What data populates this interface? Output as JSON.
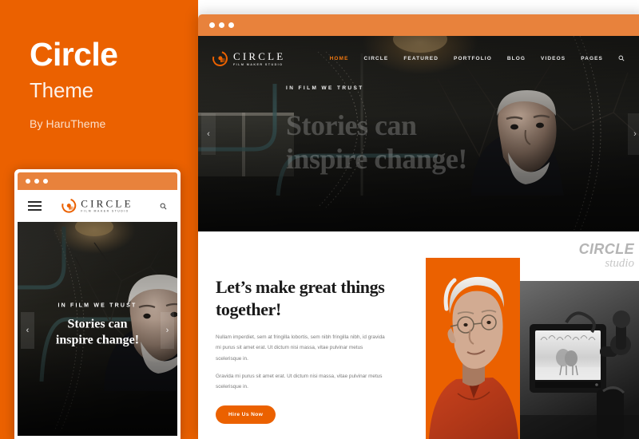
{
  "promo": {
    "title": "Circle",
    "subtitle": "Theme",
    "byline": "By HaruTheme"
  },
  "colors": {
    "brand_orange": "#EB6100",
    "chrome_orange": "#E8823C",
    "nav_active": "#F0760F",
    "page_background": "#FFFFFF"
  },
  "brand": {
    "logo_word": "CIRCLE",
    "logo_tagline": "FILM MAKER STUDIO",
    "logo_mark_icon": "circle-comet-icon"
  },
  "desktop_mockup": {
    "chrome": {
      "dots_icon": "window-dots-icon",
      "dot_count": 3
    },
    "nav": {
      "items": [
        {
          "label": "HOME",
          "active": true
        },
        {
          "label": "CIRCLE",
          "active": false
        },
        {
          "label": "FEATURED",
          "active": false
        },
        {
          "label": "PORTFOLIO",
          "active": false
        },
        {
          "label": "BLOG",
          "active": false
        },
        {
          "label": "VIDEOS",
          "active": false
        },
        {
          "label": "PAGES",
          "active": false
        }
      ],
      "search_icon": "search-icon"
    },
    "hero": {
      "eyebrow": "IN FILM WE TRUST",
      "headline_line1": "Stories can",
      "headline_line2": "inspire change!",
      "prev_icon": "chevron-left-icon",
      "prev_label": "‹",
      "next_icon": "chevron-right-icon",
      "next_label": "›"
    },
    "content": {
      "title_line1": "Let’s make great things",
      "title_line2": "together!",
      "paragraph1": "Nullam imperdiet, sem at fringilla lobortis, sem nibh fringilla nibh, id gravida mi purus sit amet erat. Ut dictum nisi massa, vitae pulvinar metus scelerisque in.",
      "paragraph2": "Gravida mi purus sit amet erat. Ut dictum nisi massa, vitae pulvinar metus scelerisque in.",
      "cta_label": "Hire Us Now",
      "wordmark_main": "CIRCLE",
      "wordmark_sub": "studio",
      "gallery": [
        {
          "name": "portrait-photo",
          "alt": "Elderly man in orange shirt on orange background"
        },
        {
          "name": "camera-monitor-photo",
          "alt": "Black and white film camera monitor"
        }
      ]
    }
  },
  "mobile_mockup": {
    "chrome": {
      "dots_icon": "window-dots-icon",
      "dot_count": 3
    },
    "header": {
      "menu_icon": "hamburger-menu-icon",
      "search_icon": "search-icon"
    },
    "hero": {
      "eyebrow": "IN FILM WE TRUST",
      "headline_line1": "Stories can",
      "headline_line2": "inspire change!",
      "prev_label": "‹",
      "next_label": "›"
    }
  }
}
